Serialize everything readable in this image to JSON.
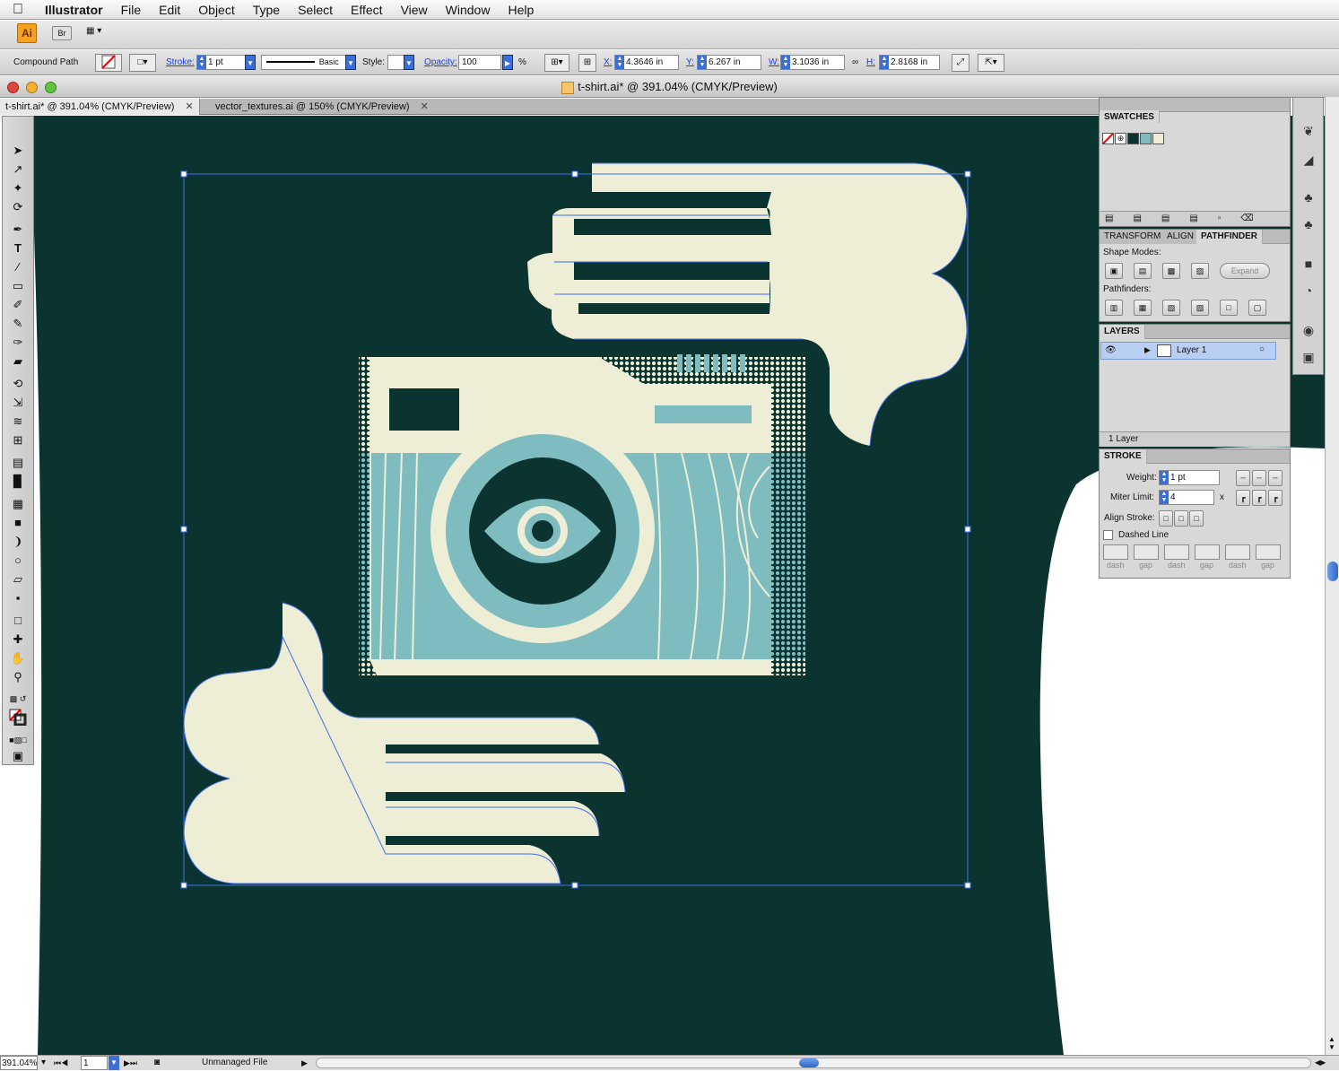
{
  "menubar": {
    "app": "Illustrator",
    "items": [
      "File",
      "Edit",
      "Object",
      "Type",
      "Select",
      "Effect",
      "View",
      "Window",
      "Help"
    ]
  },
  "appbar": {
    "ai_label": "Ai",
    "bridge_label": "Br"
  },
  "control": {
    "selection_type": "Compound Path",
    "stroke_label": "Stroke:",
    "stroke_weight": "1 pt",
    "brush": "Basic",
    "style_label": "Style:",
    "opacity_label": "Opacity:",
    "opacity": "100",
    "percent": "%",
    "x_label": "X:",
    "x": "4.3646 in",
    "y_label": "Y:",
    "y": "6.267 in",
    "w_label": "W:",
    "w": "3.1036 in",
    "h_label": "H:",
    "h": "2.8168 in"
  },
  "window": {
    "title": "t-shirt.ai* @ 391.04% (CMYK/Preview)"
  },
  "tabs": [
    {
      "label": "t-shirt.ai* @ 391.04% (CMYK/Preview)"
    },
    {
      "label": "vector_textures.ai @ 150% (CMYK/Preview)"
    }
  ],
  "swatches": {
    "title": "SWATCHES",
    "colors": [
      "#0b3430",
      "#7fbcc0",
      "#eeeed6"
    ]
  },
  "pathfinder": {
    "tabs": [
      "TRANSFORM",
      "ALIGN",
      "PATHFINDER"
    ],
    "shape_modes_label": "Shape Modes:",
    "expand_label": "Expand",
    "pathfinders_label": "Pathfinders:"
  },
  "layers": {
    "title": "LAYERS",
    "layer_name": "Layer 1",
    "count": "1 Layer"
  },
  "stroke": {
    "title": "STROKE",
    "weight_label": "Weight:",
    "weight": "1 pt",
    "miter_label": "Miter Limit:",
    "miter": "4",
    "miter_x": "x",
    "align_label": "Align Stroke:",
    "dashed_label": "Dashed Line",
    "dash_labels": [
      "dash",
      "gap",
      "dash",
      "gap",
      "dash",
      "gap"
    ]
  },
  "status": {
    "zoom": "391.04%",
    "page": "1",
    "file_status": "Unmanaged File"
  },
  "colors": {
    "canvas": "#0b3430",
    "cream": "#eeeed6",
    "teal": "#7fbcc0",
    "selection": "#3f6ee8"
  }
}
